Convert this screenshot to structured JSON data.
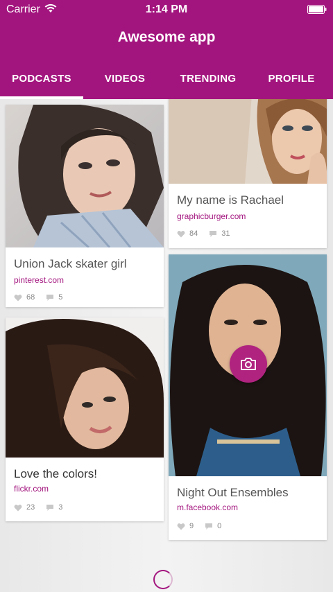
{
  "status_bar": {
    "carrier": "Carrier",
    "time": "1:14 PM"
  },
  "app": {
    "title": "Awesome app"
  },
  "tabs": [
    {
      "label": "PODCASTS",
      "active": true
    },
    {
      "label": "VIDEOS",
      "active": false
    },
    {
      "label": "TRENDING",
      "active": false
    },
    {
      "label": "PROFILE",
      "active": false
    }
  ],
  "cards": [
    {
      "title": "Union Jack skater girl",
      "source": "pinterest.com",
      "likes": "68",
      "comments": "5"
    },
    {
      "title": "My name is Rachael",
      "source": "graphicburger.com",
      "likes": "84",
      "comments": "31"
    },
    {
      "title": "Love the colors!",
      "source": "flickr.com",
      "likes": "23",
      "comments": "3"
    },
    {
      "title": "Night Out Ensembles",
      "source": "m.facebook.com",
      "likes": "9",
      "comments": "0"
    }
  ],
  "icons": {
    "like": "heart-icon",
    "comment": "comment-icon",
    "fab": "camera-icon"
  },
  "colors": {
    "brand": "#a3157e",
    "header_text": "#ffffff",
    "link": "#a3157e"
  }
}
